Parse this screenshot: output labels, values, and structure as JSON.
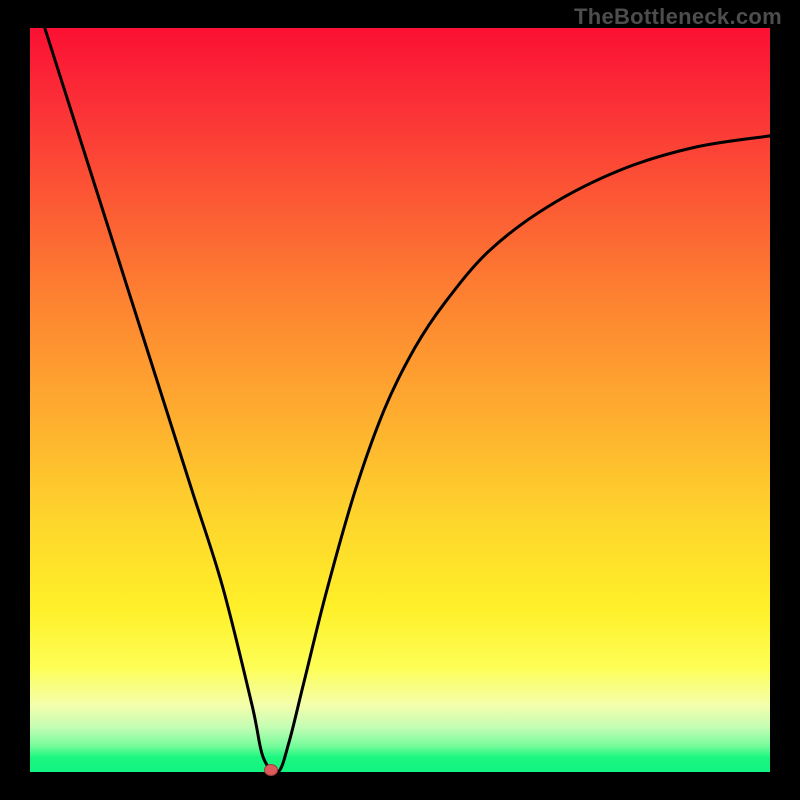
{
  "watermark": "TheBottleneck.com",
  "colors": {
    "page_bg": "#000000",
    "curve": "#000000",
    "marker_fill": "#db5b5b",
    "marker_border": "#a13d3d",
    "gradient_stops": [
      "#fb1033",
      "#fb2f37",
      "#fc5b34",
      "#fd8431",
      "#fead2f",
      "#fed52c",
      "#fff029",
      "#fdfe56",
      "#f4feac",
      "#c3fdb4",
      "#76fb9b",
      "#1cf780",
      "#12f381"
    ]
  },
  "chart_data": {
    "type": "line",
    "title": "",
    "xlabel": "",
    "ylabel": "",
    "xlim_fraction": [
      0,
      1
    ],
    "ylim_fraction": [
      0,
      1
    ],
    "note": "Axes have no tick labels; x and y given as fractions of the plot area width/height with origin at lower-left.",
    "series": [
      {
        "name": "bottleneck-curve",
        "x": [
          0.02,
          0.06,
          0.1,
          0.14,
          0.18,
          0.22,
          0.26,
          0.3,
          0.315,
          0.335,
          0.35,
          0.37,
          0.4,
          0.44,
          0.48,
          0.52,
          0.56,
          0.62,
          0.7,
          0.8,
          0.9,
          1.0
        ],
        "y": [
          1.0,
          0.875,
          0.75,
          0.625,
          0.5,
          0.375,
          0.25,
          0.09,
          0.02,
          0.0,
          0.04,
          0.12,
          0.24,
          0.38,
          0.49,
          0.57,
          0.63,
          0.7,
          0.76,
          0.81,
          0.84,
          0.855
        ]
      }
    ],
    "marker": {
      "x": 0.332,
      "y": 0.0,
      "color": "#db5b5b"
    },
    "background_scale": {
      "orientation": "vertical",
      "meaning": "red at top indicates high bottleneck, green at bottom indicates low bottleneck"
    }
  }
}
